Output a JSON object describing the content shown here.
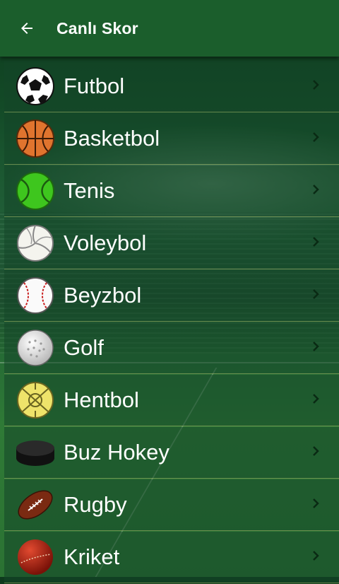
{
  "header": {
    "title": "Canlı Skor",
    "back_icon": "arrow-left-icon"
  },
  "sports": [
    {
      "label": "Futbol",
      "icon": "soccer-ball-icon"
    },
    {
      "label": "Basketbol",
      "icon": "basketball-icon"
    },
    {
      "label": "Tenis",
      "icon": "tennis-ball-icon"
    },
    {
      "label": "Voleybol",
      "icon": "volleyball-icon"
    },
    {
      "label": "Beyzbol",
      "icon": "baseball-icon"
    },
    {
      "label": "Golf",
      "icon": "golf-ball-icon"
    },
    {
      "label": "Hentbol",
      "icon": "handball-icon"
    },
    {
      "label": "Buz Hokey",
      "icon": "hockey-puck-icon"
    },
    {
      "label": "Rugby",
      "icon": "rugby-ball-icon"
    },
    {
      "label": "Kriket",
      "icon": "cricket-ball-icon"
    }
  ],
  "colors": {
    "appbar": "#1b5e2c",
    "row_divider": "#c8d278",
    "text": "#ffffff"
  }
}
